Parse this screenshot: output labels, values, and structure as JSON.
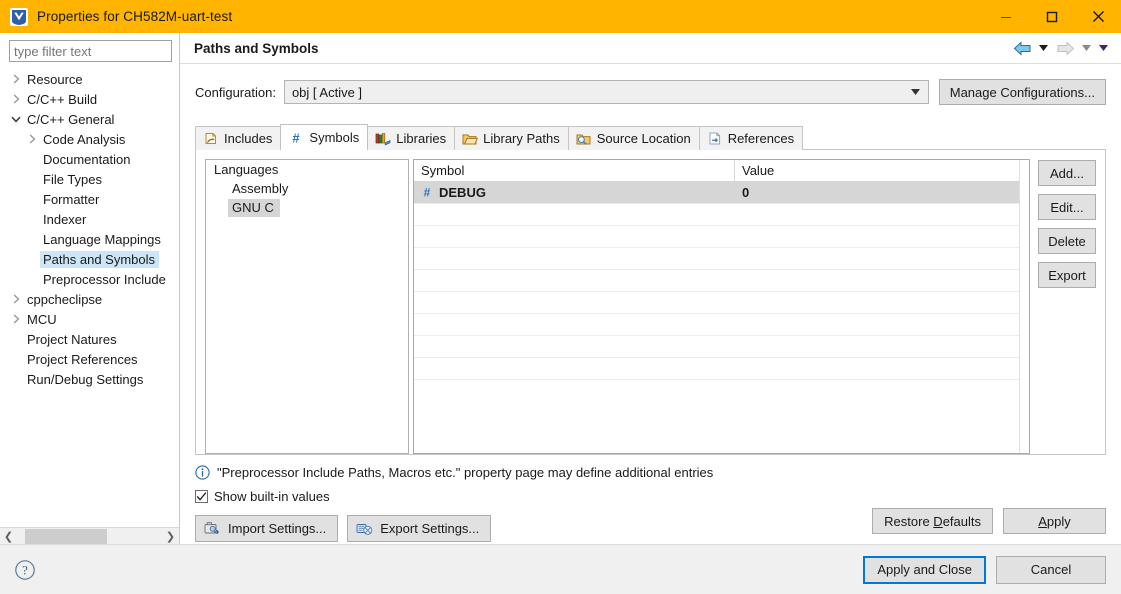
{
  "window": {
    "title": "Properties for CH582M-uart-test",
    "icon": "eclipse-logo-icon",
    "titlebar_color": "#ffb400",
    "minimize_label": "–",
    "maximize_label": "□",
    "close_label": "✕"
  },
  "sidebar": {
    "filter": {
      "value": "",
      "placeholder": "type filter text"
    },
    "items": [
      {
        "label": "Resource",
        "indent": 0,
        "twisty": "collapsed",
        "selected": false
      },
      {
        "label": "C/C++ Build",
        "indent": 0,
        "twisty": "collapsed",
        "selected": false
      },
      {
        "label": "C/C++ General",
        "indent": 0,
        "twisty": "expanded",
        "selected": false
      },
      {
        "label": "Code Analysis",
        "indent": 1,
        "twisty": "collapsed",
        "selected": false
      },
      {
        "label": "Documentation",
        "indent": 1,
        "twisty": "none",
        "selected": false
      },
      {
        "label": "File Types",
        "indent": 1,
        "twisty": "none",
        "selected": false
      },
      {
        "label": "Formatter",
        "indent": 1,
        "twisty": "none",
        "selected": false
      },
      {
        "label": "Indexer",
        "indent": 1,
        "twisty": "none",
        "selected": false
      },
      {
        "label": "Language Mappings",
        "indent": 1,
        "twisty": "none",
        "selected": false
      },
      {
        "label": "Paths and Symbols",
        "indent": 1,
        "twisty": "none",
        "selected": true
      },
      {
        "label": "Preprocessor Include",
        "indent": 1,
        "twisty": "none",
        "selected": false
      },
      {
        "label": "cppcheclipse",
        "indent": 0,
        "twisty": "collapsed",
        "selected": false
      },
      {
        "label": "MCU",
        "indent": 0,
        "twisty": "collapsed",
        "selected": false
      },
      {
        "label": "Project Natures",
        "indent": 0,
        "twisty": "none",
        "selected": false
      },
      {
        "label": "Project References",
        "indent": 0,
        "twisty": "none",
        "selected": false
      },
      {
        "label": "Run/Debug Settings",
        "indent": 0,
        "twisty": "none",
        "selected": false
      }
    ],
    "selection_color": "#cde6f7"
  },
  "page": {
    "title": "Paths and Symbols",
    "nav": {
      "back_icon": "back-arrow-icon",
      "back_menu_icon": "chevron-down-icon",
      "forward_icon": "forward-arrow-icon",
      "forward_menu_icon": "chevron-down-icon",
      "more_menu_icon": "chevron-down-icon",
      "back_enabled": true,
      "forward_enabled": false
    }
  },
  "configuration": {
    "label": "Configuration:",
    "value": "obj  [ Active ]",
    "manage_label": "Manage Configurations..."
  },
  "tabs": [
    {
      "label": "Includes",
      "icon": "includes-icon",
      "active": false
    },
    {
      "label": "Symbols",
      "icon": "hash-icon",
      "active": true
    },
    {
      "label": "Libraries",
      "icon": "libraries-icon",
      "active": false
    },
    {
      "label": "Library Paths",
      "icon": "library-paths-icon",
      "active": false
    },
    {
      "label": "Source Location",
      "icon": "source-location-icon",
      "active": false
    },
    {
      "label": "References",
      "icon": "references-icon",
      "active": false
    }
  ],
  "languages": {
    "header": "Languages",
    "items": [
      {
        "label": "Assembly",
        "selected": false
      },
      {
        "label": "GNU C",
        "selected": true
      }
    ]
  },
  "symbols_table": {
    "columns": [
      "Symbol",
      "Value"
    ],
    "rows": [
      {
        "symbol": "DEBUG",
        "value": "0",
        "icon": "hash-icon",
        "selected": true
      }
    ],
    "empty_rows": 8
  },
  "side_buttons": [
    {
      "label": "Add..."
    },
    {
      "label": "Edit..."
    },
    {
      "label": "Delete"
    },
    {
      "label": "Export"
    }
  ],
  "note": {
    "icon": "info-icon",
    "text": "\"Preprocessor Include Paths, Macros etc.\" property page may define additional entries"
  },
  "show_builtin": {
    "label": "Show built-in values",
    "checked": true,
    "check_glyph": "✓"
  },
  "settings_buttons": [
    {
      "label": "Import Settings...",
      "icon": "import-settings-icon"
    },
    {
      "label": "Export Settings...",
      "icon": "export-settings-icon"
    }
  ],
  "apply_bar": {
    "restore_pre": "Restore ",
    "restore_mnemonic": "D",
    "restore_post": "efaults",
    "apply_mnemonic": "A",
    "apply_post": "pply"
  },
  "footer": {
    "help_icon": "help-icon",
    "apply_and_close": "Apply and Close",
    "cancel": "Cancel",
    "default_border_color": "#0078d7"
  }
}
